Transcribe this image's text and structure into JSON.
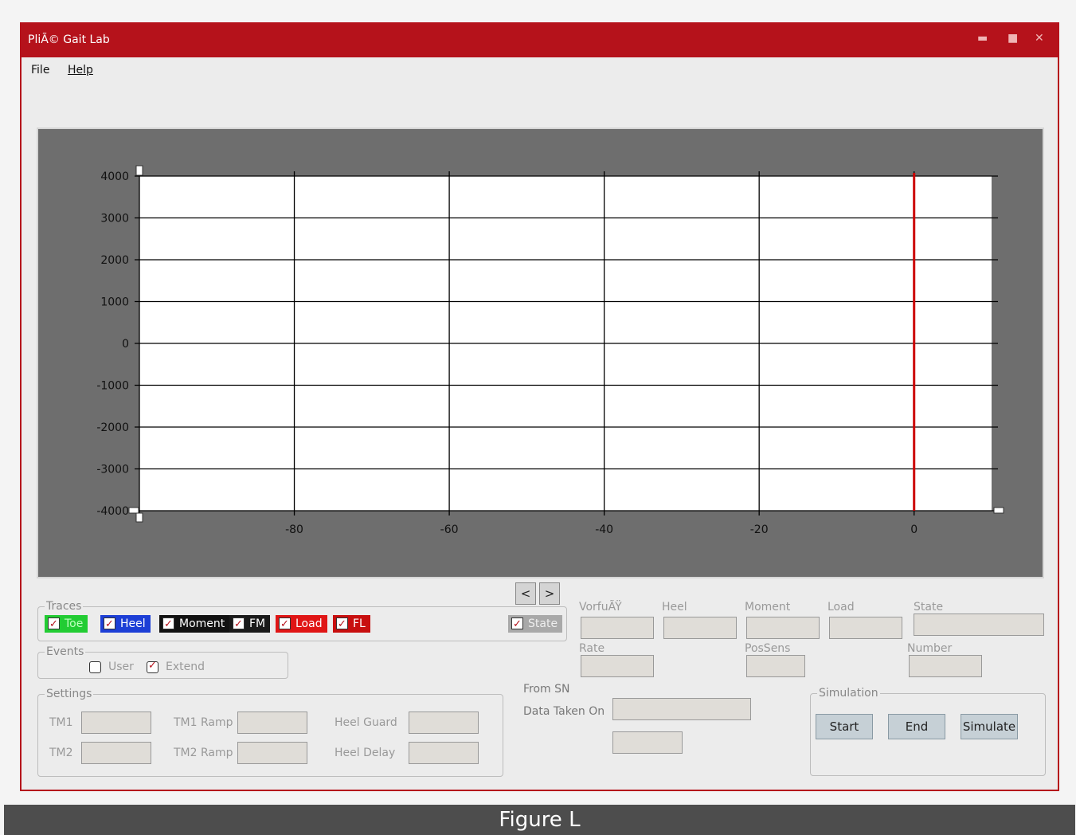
{
  "window": {
    "title": "PliÃ© Gait Lab",
    "min_glyph": "▬",
    "max_glyph": "■",
    "close_glyph": "✕"
  },
  "menu": {
    "file": "File",
    "help": "Help"
  },
  "chart_data": {
    "type": "line",
    "xlim": [
      -100,
      10
    ],
    "ylim": [
      -4000,
      4000
    ],
    "x_ticks": [
      -80,
      -60,
      -40,
      -20,
      0
    ],
    "y_ticks": [
      4000,
      3000,
      2000,
      1000,
      0,
      -1000,
      -2000,
      -3000,
      -4000
    ],
    "x_tick_labels": [
      "-80",
      "-60",
      "-40",
      "-20",
      "0"
    ],
    "y_tick_labels": [
      "4000",
      "3000",
      "2000",
      "1000",
      "0",
      "-1000",
      "-2000",
      "-3000",
      "-4000"
    ],
    "cursor_x": 0,
    "cursor_color": "#cc0000",
    "grid": true,
    "series": []
  },
  "nav": {
    "prev": "<",
    "next": ">"
  },
  "traces": {
    "legend": "Traces",
    "items": [
      {
        "label": "Toe",
        "color": "#22cc33",
        "text_color": "#bfffbf",
        "checked": true
      },
      {
        "label": "Heel",
        "color": "#1d3fd6",
        "text_color": "#ffffff",
        "checked": true
      },
      {
        "label": "Moment",
        "color": "#111111",
        "text_color": "#ffffff",
        "checked": true
      },
      {
        "label": "FM",
        "color": "#1a1a1a",
        "text_color": "#ffffff",
        "checked": true
      },
      {
        "label": "Load",
        "color": "#e01515",
        "text_color": "#ffffff",
        "checked": true
      },
      {
        "label": "FL",
        "color": "#c80f0f",
        "text_color": "#ffffff",
        "checked": true
      }
    ],
    "state": {
      "label": "State",
      "color": "#a9a9a9",
      "text_color": "#eeeeee",
      "checked": true
    }
  },
  "events": {
    "legend": "Events",
    "user": "User",
    "user_checked": false,
    "extend": "Extend",
    "extend_checked": true
  },
  "settings": {
    "legend": "Settings",
    "tm1": "TM1",
    "tm2": "TM2",
    "tm1_ramp": "TM1 Ramp",
    "tm2_ramp": "TM2 Ramp",
    "heel_guard": "Heel Guard",
    "heel_delay": "Heel Delay"
  },
  "readouts": {
    "vorfuss": "VorfuÃŸ",
    "heel": "Heel",
    "moment": "Moment",
    "load": "Load",
    "state": "State",
    "rate": "Rate",
    "possens": "PosSens",
    "number": "Number"
  },
  "info": {
    "from_sn": "From SN",
    "data_taken_on": "Data Taken On"
  },
  "simulation": {
    "legend": "Simulation",
    "start": "Start",
    "end": "End",
    "simulate": "Simulate"
  },
  "caption": "Figure L"
}
